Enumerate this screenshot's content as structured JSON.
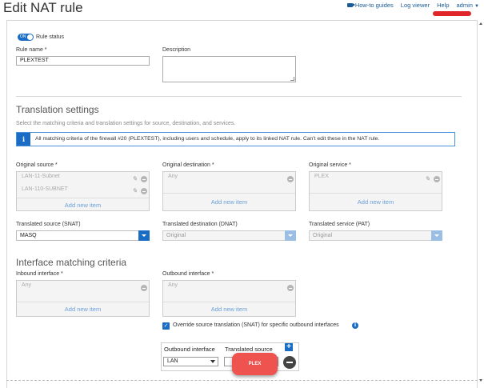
{
  "header": {
    "title": "Edit NAT rule",
    "links": {
      "howto": "How-to guides",
      "logviewer": "Log viewer",
      "help": "Help",
      "user": "admin"
    }
  },
  "rule": {
    "status_toggle": "ON",
    "status_label": "Rule status",
    "name_label": "Rule name *",
    "name_value": "PLEXTEST",
    "description_label": "Description",
    "description_value": ""
  },
  "translation": {
    "title": "Translation settings",
    "subtitle": "Select the matching criteria and translation settings for source, destination, and services.",
    "info": "All matching criteria of the firewall #20 (PLEXTEST), including users and schedule, apply to its linked NAT rule. Can't edit these in the NAT rule.",
    "orig_source_label": "Original source *",
    "orig_source_items": [
      "LAN-11-Subnet",
      "LAN-110-SUBNET"
    ],
    "orig_dest_label": "Original destination *",
    "orig_dest_items": [
      "Any"
    ],
    "orig_service_label": "Original service *",
    "orig_service_items": [
      "PLEX"
    ],
    "add_new": "Add new item",
    "snat_label": "Translated source (SNAT)",
    "snat_value": "MASQ",
    "dnat_label": "Translated destination (DNAT)",
    "dnat_value": "Original",
    "pat_label": "Translated service (PAT)",
    "pat_value": "Original"
  },
  "interfaces": {
    "title": "Interface matching criteria",
    "inbound_label": "Inbound interface *",
    "inbound_items": [
      "Any"
    ],
    "outbound_label": "Outbound interface *",
    "outbound_items": [
      "Any"
    ],
    "add_new": "Add new item",
    "override_label": "Override source translation (SNAT) for specific outbound interfaces",
    "override_checked": true,
    "table": {
      "col_interface": "Outbound interface",
      "col_source": "Translated source",
      "row_interface": "LAN",
      "row_source": "PLEX"
    }
  },
  "colors": {
    "accent": "#1a6cc4",
    "annotation": "#e0262a",
    "highlight": "#ef5350"
  }
}
